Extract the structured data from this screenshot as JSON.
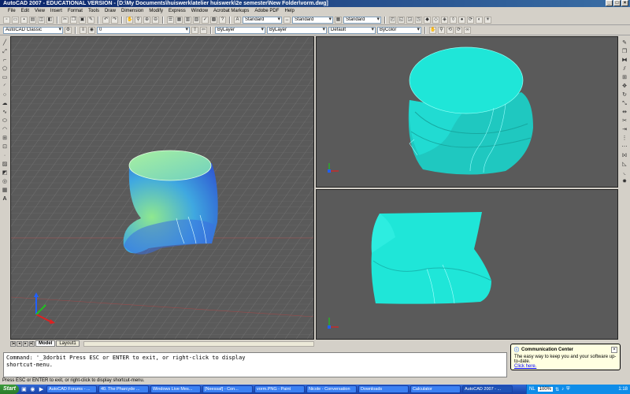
{
  "window": {
    "title": "AutoCAD 2007 - EDUCATIONAL VERSION - [D:\\My Documents\\huiswerk\\atelier huiswerk\\2e semester\\New Folder\\vorm.dwg]"
  },
  "menu": [
    "File",
    "Edit",
    "View",
    "Insert",
    "Format",
    "Tools",
    "Draw",
    "Dimension",
    "Modify",
    "Express",
    "Window",
    "Acrobat Markups",
    "Adobe PDF",
    "Help"
  ],
  "toolbar": {
    "text_style": "Standard",
    "dim_style": "Standard",
    "table_style": "Standard",
    "workspace": "AutoCAD Classic",
    "layer": "0",
    "color": "ByLayer",
    "linetype": "ByLayer",
    "lineweight": "Default",
    "plotstyle": "ByColor"
  },
  "layout_tabs": [
    "Model",
    "Layout1"
  ],
  "command_lines": [
    "Command: '_3dorbit Press ESC or ENTER to exit, or right-click to display",
    "shortcut-menu."
  ],
  "status_text": "Press ESC or ENTER to exit, or right-click to display shortcut-menu.",
  "popup": {
    "title": "Communication Center",
    "body": "The easy way to keep you and your software up-to-date.",
    "link": "Click here."
  },
  "taskbar": {
    "start_label": "Start",
    "tasks": [
      "AutoCAD Forums - ...",
      "40. The Pharcyde ...",
      "Windows Live Mes...",
      "[Neessaf] - Con...",
      "vorm.PNG - Paint",
      "Nicole - Conversation",
      "Downloads",
      "Calculator",
      "AutoCAD 2007 - ..."
    ],
    "active_task_index": 8,
    "lang": "NL",
    "zoom": "100%",
    "clock": "1:18"
  },
  "colors": {
    "viewport_bg": "#5a5a5a",
    "object_cyan": "#1fe6d8",
    "axis_x": "#e02020",
    "axis_y": "#20c020",
    "axis_z": "#2060ff"
  },
  "icons": {
    "left_tools": [
      "line-icon",
      "construction-line-icon",
      "polyline-icon",
      "polygon-icon",
      "rectangle-icon",
      "arc-icon",
      "circle-icon",
      "revision-cloud-icon",
      "spline-icon",
      "ellipse-icon",
      "ellipse-arc-icon",
      "insert-block-icon",
      "make-block-icon",
      "point-icon",
      "hatch-icon",
      "gradient-icon",
      "region-icon",
      "table-icon",
      "mtext-icon"
    ],
    "right_tools": [
      "erase-icon",
      "copy-icon",
      "mirror-icon",
      "offset-icon",
      "array-icon",
      "move-icon",
      "rotate-icon",
      "scale-icon",
      "stretch-icon",
      "trim-icon",
      "extend-icon",
      "break-at-point-icon",
      "break-icon",
      "join-icon",
      "chamfer-icon",
      "fillet-icon",
      "explode-icon"
    ]
  }
}
